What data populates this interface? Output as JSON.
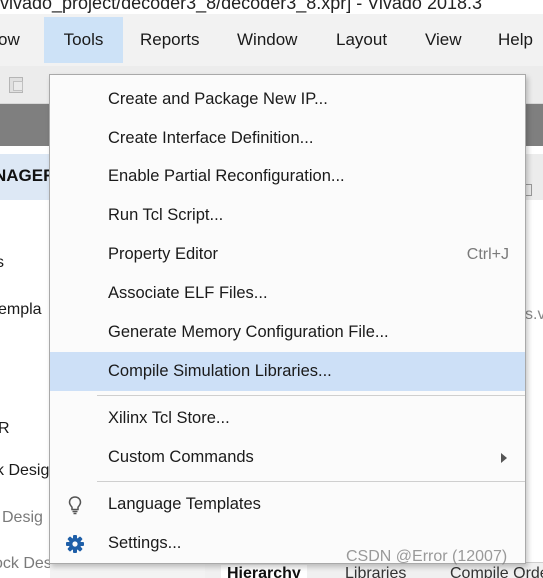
{
  "window": {
    "title": "vivado_project/decoder3_8/decoder3_8.xpr] - Vivado 2018.3"
  },
  "menubar": {
    "items": [
      {
        "label": "ow"
      },
      {
        "label": "Tools"
      },
      {
        "label": "Reports"
      },
      {
        "label": "Window"
      },
      {
        "label": "Layout"
      },
      {
        "label": "View"
      },
      {
        "label": "Help"
      }
    ],
    "active": "Tools"
  },
  "flow_navigator": {
    "header": "NAGER",
    "items": [
      {
        "label": "s"
      },
      {
        "label": "empla"
      },
      {
        "label": "R"
      },
      {
        "label": "k Desig"
      },
      {
        "label": "Desig"
      },
      {
        "label": "ock Design"
      }
    ]
  },
  "right_pane": {
    "fragment": "s.v"
  },
  "bottom_tabs": {
    "tabs": [
      {
        "label": "Hierarchy"
      },
      {
        "label": "Libraries"
      },
      {
        "label": "Compile Order"
      }
    ],
    "selected": "Hierarchy"
  },
  "tools_menu": {
    "items": [
      {
        "label": "Create and Package New IP..."
      },
      {
        "label": "Create Interface Definition..."
      },
      {
        "label": "Enable Partial Reconfiguration..."
      },
      {
        "label": "Run Tcl Script..."
      },
      {
        "label": "Property Editor",
        "shortcut": "Ctrl+J"
      },
      {
        "label": "Associate ELF Files..."
      },
      {
        "label": "Generate Memory Configuration File..."
      },
      {
        "label": "Compile Simulation Libraries..."
      },
      {
        "label": "Xilinx Tcl Store..."
      },
      {
        "label": "Custom Commands",
        "submenu": true
      },
      {
        "label": "Language Templates",
        "icon": "lightbulb-icon"
      },
      {
        "label": "Settings...",
        "icon": "gear-icon"
      }
    ],
    "highlighted": "Compile Simulation Libraries..."
  },
  "watermark": {
    "text": "CSDN @Error (12007)"
  },
  "colors": {
    "menu_highlight": "#cde0f7",
    "active_menu": "#cde2f7",
    "icon_blue": "#1f5fa8",
    "toolbar_dark": "#7f7f7f"
  }
}
